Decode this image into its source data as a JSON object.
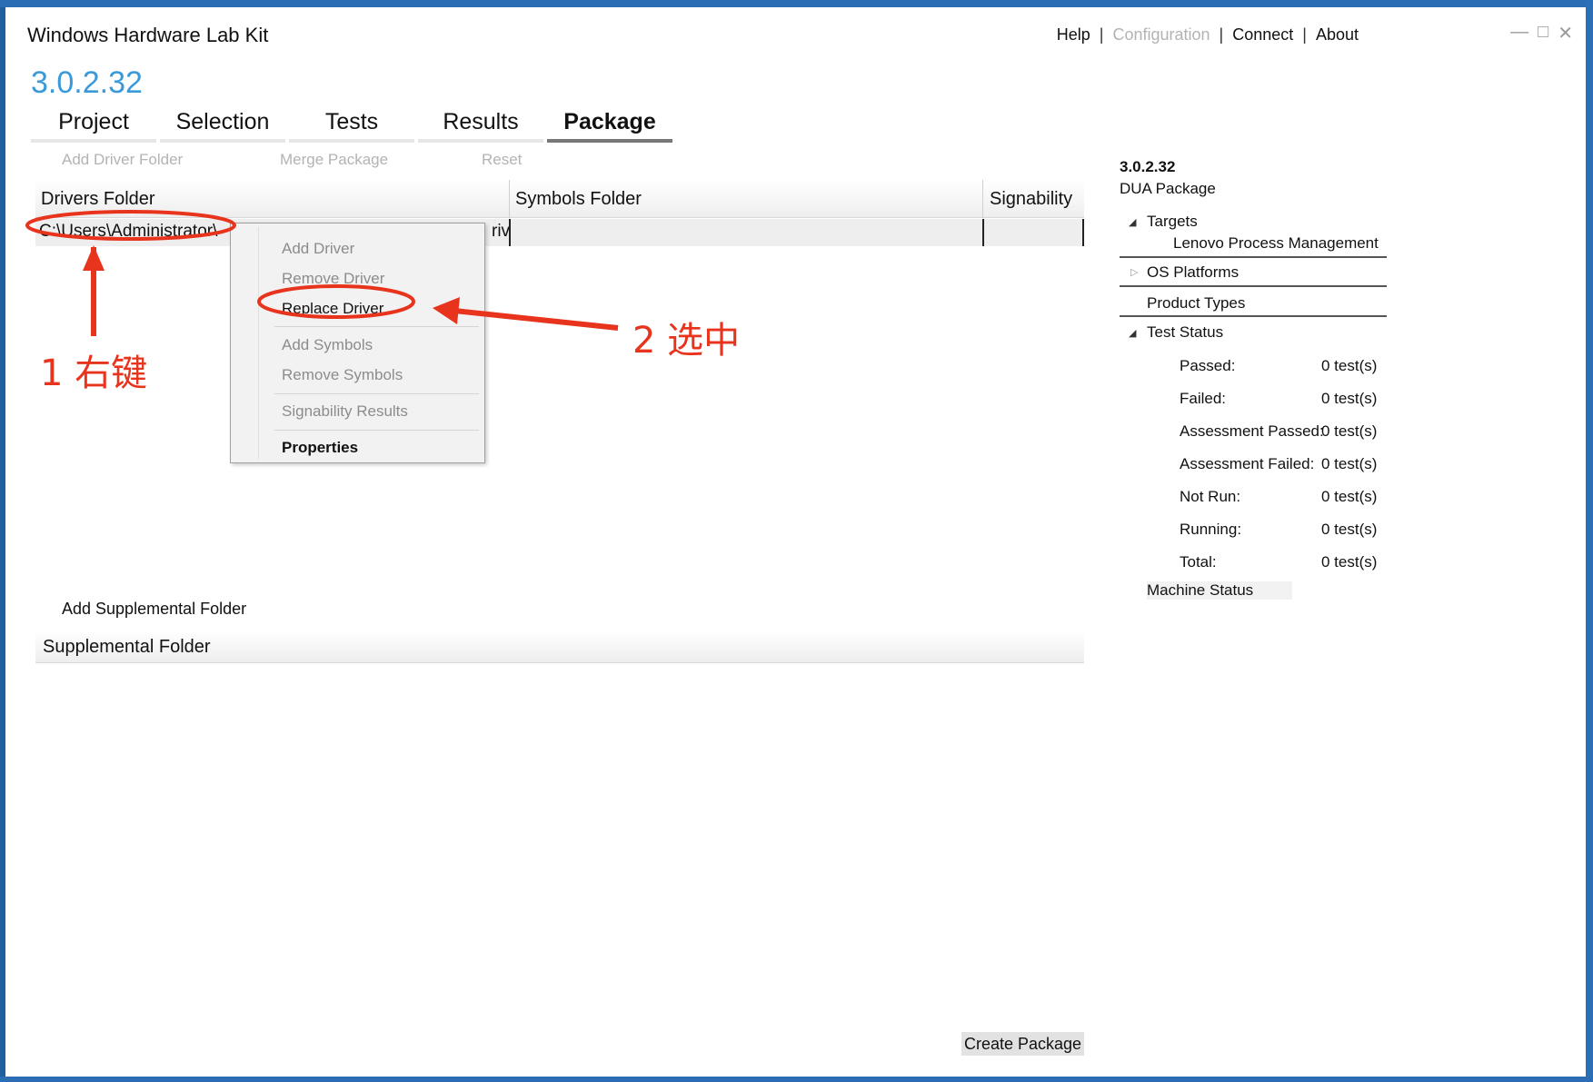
{
  "window": {
    "title": "Windows Hardware Lab Kit",
    "version": "3.0.2.32"
  },
  "top_links": {
    "help": "Help",
    "configuration": "Configuration",
    "connect": "Connect",
    "about": "About",
    "separator": "|"
  },
  "tabs": [
    {
      "label": "Project"
    },
    {
      "label": "Selection"
    },
    {
      "label": "Tests"
    },
    {
      "label": "Results"
    },
    {
      "label": "Package"
    }
  ],
  "toolbar": {
    "add_driver_folder": "Add Driver Folder",
    "merge_package": "Merge Package",
    "reset": "Reset"
  },
  "drivers_grid": {
    "columns": [
      "Drivers Folder",
      "Symbols Folder",
      "Signability"
    ],
    "row_left": "C:\\Users\\Administrator\\",
    "row_right": "riv"
  },
  "context_menu": {
    "items": [
      "Add Driver",
      "Remove Driver",
      "Replace Driver",
      "Add Symbols",
      "Remove Symbols",
      "Signability Results",
      "Properties"
    ]
  },
  "supplemental": {
    "add_label": "Add Supplemental Folder",
    "header": "Supplemental Folder"
  },
  "create_package_label": "Create Package",
  "right_panel": {
    "version": "3.0.2.32",
    "package_name": "DUA Package",
    "targets_label": "Targets",
    "target_value": "Lenovo Process Management",
    "os_platforms_label": "OS Platforms",
    "product_types_label": "Product Types",
    "test_status_label": "Test Status",
    "status_rows": [
      {
        "label": "Passed:",
        "value": "0 test(s)"
      },
      {
        "label": "Failed:",
        "value": "0 test(s)"
      },
      {
        "label": "Assessment Passed:",
        "value": "0 test(s)"
      },
      {
        "label": "Assessment Failed:",
        "value": "0 test(s)"
      },
      {
        "label": "Not Run:",
        "value": "0 test(s)"
      },
      {
        "label": "Running:",
        "value": "0 test(s)"
      },
      {
        "label": "Total:",
        "value": "0 test(s)"
      }
    ],
    "machine_status_label": "Machine Status"
  },
  "annotations": {
    "step1": "1 右键",
    "step2": "2 选中",
    "color": "#e8341c"
  }
}
